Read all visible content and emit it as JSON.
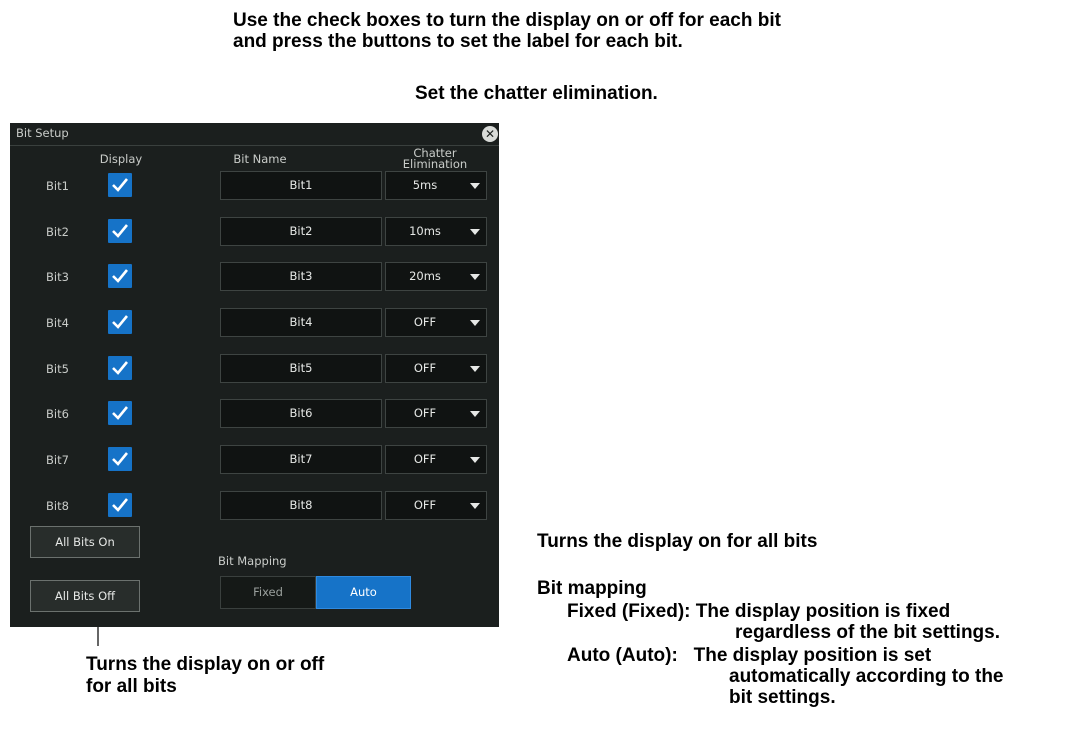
{
  "annotations": {
    "top_line1": "Use the check boxes to turn the display on or off for each bit",
    "top_line2": "and press the buttons to set the label for each bit.",
    "chatter": "Set the chatter elimination.",
    "all_on": "Turns the display on for all bits",
    "all_off_line1": "Turns the display on or off",
    "all_off_line2": "for all bits",
    "mapping_title": "Bit mapping",
    "mapping_fixed_1": "Fixed (Fixed): The display position is fixed",
    "mapping_fixed_2": "regardless of the bit settings.",
    "mapping_auto_1": "Auto (Auto):   The display position is set",
    "mapping_auto_2": "automatically according to the",
    "mapping_auto_3": "bit settings."
  },
  "dialog": {
    "title": "Bit Setup",
    "close_symbol": "✕",
    "headers": {
      "display": "Display",
      "bit_name": "Bit Name",
      "chatter_1": "Chatter",
      "chatter_2": "Elimination"
    },
    "rows": [
      {
        "label": "Bit1",
        "checked": true,
        "name": "Bit1",
        "chatter": "5ms"
      },
      {
        "label": "Bit2",
        "checked": true,
        "name": "Bit2",
        "chatter": "10ms"
      },
      {
        "label": "Bit3",
        "checked": true,
        "name": "Bit3",
        "chatter": "20ms"
      },
      {
        "label": "Bit4",
        "checked": true,
        "name": "Bit4",
        "chatter": "OFF"
      },
      {
        "label": "Bit5",
        "checked": true,
        "name": "Bit5",
        "chatter": "OFF"
      },
      {
        "label": "Bit6",
        "checked": true,
        "name": "Bit6",
        "chatter": "OFF"
      },
      {
        "label": "Bit7",
        "checked": true,
        "name": "Bit7",
        "chatter": "OFF"
      },
      {
        "label": "Bit8",
        "checked": true,
        "name": "Bit8",
        "chatter": "OFF"
      }
    ],
    "all_bits_on": "All Bits On",
    "all_bits_off": "All Bits Off",
    "bit_mapping_label": "Bit Mapping",
    "mapping_options": [
      "Fixed",
      "Auto"
    ],
    "mapping_selected": "Auto"
  },
  "colors": {
    "panel_bg": "#1b1f1e",
    "accent": "#1673c8",
    "text": "#c9ccc9"
  },
  "icons": {
    "check": "check-icon",
    "close": "close-icon",
    "dropdown": "chevron-down-icon"
  }
}
